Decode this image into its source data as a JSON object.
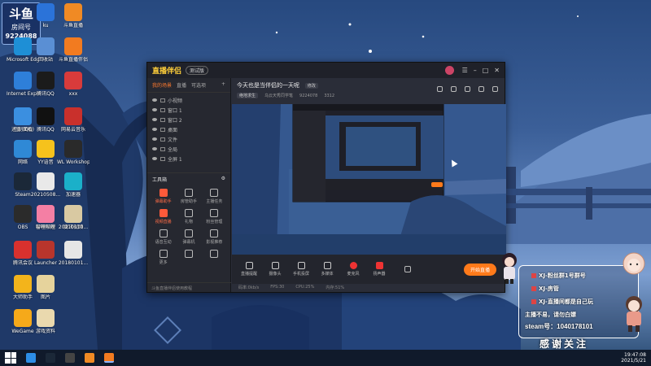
{
  "room_badge": {
    "logo": "斗鱼",
    "label": "房间号",
    "number": "9224088"
  },
  "desktop_icons": [
    {
      "label": "此电脑",
      "color": "#3a8ee6"
    },
    {
      "label": "ku",
      "color": "#2b73d9"
    },
    {
      "label": "斗鱼直播",
      "color": "#f08a24"
    },
    {
      "label": "Microsoft Edge",
      "color": "#1e8fd6"
    },
    {
      "label": "回收站",
      "color": "#5a8fd4"
    },
    {
      "label": "斗鱼直播伴侣",
      "color": "#f27b20"
    },
    {
      "label": "Internet Explorer",
      "color": "#2e7fd9"
    },
    {
      "label": "腾讯QQ",
      "color": "#1b1b1b"
    },
    {
      "label": "xxx",
      "color": "#d83b3b"
    },
    {
      "label": "迅雷 (QQ)",
      "color": "#2b7bde"
    },
    {
      "label": "腾讯QQ",
      "color": "#111111"
    },
    {
      "label": "网易云音乐",
      "color": "#c9302c"
    },
    {
      "label": "控制面板",
      "color": "#3b8fe0"
    },
    {
      "label": "网络",
      "color": "#2f89d6"
    },
    {
      "label": "YY语音",
      "color": "#f6c21c"
    },
    {
      "label": "WL Workshop",
      "color": "#2a2a2a"
    },
    {
      "label": "Steam",
      "color": "#1b2838"
    },
    {
      "label": "20210508...",
      "color": "#e9e9e9"
    },
    {
      "label": "加速器",
      "color": "#1bb0c9"
    },
    {
      "label": "OBS",
      "color": "#2b2b2b"
    },
    {
      "label": "雷神加速",
      "color": "#e14b3a"
    },
    {
      "label": "腾讯视频",
      "color": "#2f9be8"
    },
    {
      "label": "哔哩哔哩",
      "color": "#f47fa4"
    },
    {
      "label": "20210110...",
      "color": "#d9c9a2"
    },
    {
      "label": "腾讯会议",
      "color": "#d8312e"
    },
    {
      "label": "Launcher",
      "color": "#b8352c"
    },
    {
      "label": "20180101...",
      "color": "#e6e6e6"
    },
    {
      "label": "大师助手",
      "color": "#f3b41b"
    },
    {
      "label": "图片",
      "color": "#e6d39c"
    },
    {
      "label": "WeGame",
      "color": "#f5a91a"
    },
    {
      "label": "游戏资料",
      "color": "#ead9ae"
    }
  ],
  "main_window": {
    "app_name": "直播伴侣",
    "version": "测试版",
    "tabs": [
      "我的场景",
      "直播",
      "可选项"
    ],
    "scenes": [
      "小视频",
      "窗口 1",
      "窗口 2",
      "桌面",
      "文件",
      "全局",
      "全屏 1"
    ],
    "tools_title": "工具箱",
    "tools": [
      {
        "label": "弹幕助手",
        "hot": true
      },
      {
        "label": "房管助手",
        "hot": false
      },
      {
        "label": "主播任务",
        "hot": false
      },
      {
        "label": "视频直播",
        "hot": true
      },
      {
        "label": "礼物",
        "hot": false
      },
      {
        "label": "粉丝管理",
        "hot": false
      },
      {
        "label": "语音互动",
        "hot": false
      },
      {
        "label": "弹幕机",
        "hot": false
      },
      {
        "label": "影视推荐",
        "hot": false
      },
      {
        "label": "更多",
        "hot": false
      },
      {
        "label": "",
        "hot": false
      },
      {
        "label": "",
        "hot": false
      }
    ],
    "bottom_left": "斗鱼直播伴侣使用教程",
    "room_title": "今天也是当伴侣的一天呢",
    "edit_tag": "修改",
    "category": "绝地求生",
    "streamer": "乌云天秀同学笔",
    "room_id": "9224078",
    "heat": "3312",
    "toolbar": [
      {
        "label": "直播提醒",
        "kind": ""
      },
      {
        "label": "摄像头",
        "kind": ""
      },
      {
        "label": "手机投屏",
        "kind": ""
      },
      {
        "label": "多媒体",
        "kind": ""
      },
      {
        "label": "麦克风",
        "kind": "mic"
      },
      {
        "label": "扬声器",
        "kind": "spk"
      }
    ],
    "start_button": "开始直播",
    "status": [
      "码率:0kb/s",
      "FPS:30",
      "CPU:25%",
      "内存:51%"
    ]
  },
  "overlay": {
    "lines": [
      "XJ-粉丝群1号群号",
      "XJ-房管",
      "XJ-直播间都是自己玩",
      "主播不易，请勿白嫖"
    ],
    "steam": "steam号：1040178101",
    "thanks": "感谢关注"
  },
  "taskbar": {
    "time": "19:47:08",
    "date": "2021/5/21"
  }
}
